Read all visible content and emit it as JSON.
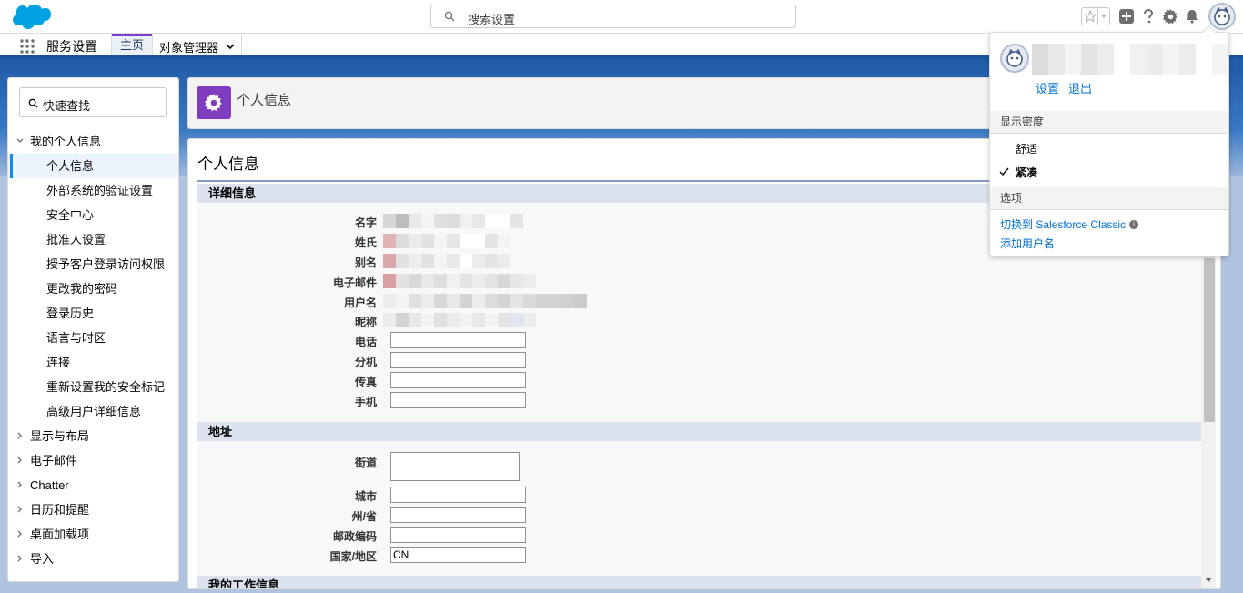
{
  "global_header": {
    "search_placeholder": "搜索设置"
  },
  "nav": {
    "app_name": "服务设置",
    "tabs": [
      {
        "label": "主页"
      },
      {
        "label": "对象管理器"
      }
    ]
  },
  "sidebar": {
    "quickfind_placeholder": "快速查找",
    "items": [
      {
        "label": "我的个人信息"
      },
      {
        "label": "个人信息"
      },
      {
        "label": "外部系统的验证设置"
      },
      {
        "label": "安全中心"
      },
      {
        "label": "批准人设置"
      },
      {
        "label": "授予客户登录访问权限"
      },
      {
        "label": "更改我的密码"
      },
      {
        "label": "登录历史"
      },
      {
        "label": "语言与时区"
      },
      {
        "label": "连接"
      },
      {
        "label": "重新设置我的安全标记"
      },
      {
        "label": "高级用户详细信息"
      },
      {
        "label": "显示与布局"
      },
      {
        "label": "电子邮件"
      },
      {
        "label": "Chatter"
      },
      {
        "label": "日历和提醒"
      },
      {
        "label": "桌面加载项"
      },
      {
        "label": "导入"
      }
    ]
  },
  "page_header": {
    "title": "个人信息"
  },
  "content": {
    "title": "个人信息",
    "sections": [
      {
        "title": "详细信息",
        "fields": [
          {
            "label": "名字"
          },
          {
            "label": "姓氏"
          },
          {
            "label": "别名"
          },
          {
            "label": "电子邮件"
          },
          {
            "label": "用户名"
          },
          {
            "label": "昵称"
          },
          {
            "label": "电话",
            "value": ""
          },
          {
            "label": "分机",
            "value": ""
          },
          {
            "label": "传真",
            "value": ""
          },
          {
            "label": "手机",
            "value": ""
          }
        ]
      },
      {
        "title": "地址",
        "fields": [
          {
            "label": "街道",
            "value": ""
          },
          {
            "label": "城市",
            "value": ""
          },
          {
            "label": "州/省",
            "value": ""
          },
          {
            "label": "邮政编码",
            "value": ""
          },
          {
            "label": "国家/地区",
            "value": "CN"
          }
        ]
      },
      {
        "title": "我的工作信息"
      }
    ]
  },
  "user_panel": {
    "links": [
      {
        "label": "设置"
      },
      {
        "label": "退出"
      }
    ],
    "density_title": "显示密度",
    "density_options": [
      {
        "label": "舒适",
        "checked": false
      },
      {
        "label": "紧凑",
        "checked": true
      }
    ],
    "options_title": "选项",
    "option_links": [
      {
        "label": "切换到 Salesforce Classic"
      },
      {
        "label": "添加用户名"
      }
    ]
  },
  "colors": {
    "brand_blue": "#1b5297",
    "link": "#0070d2",
    "gear_tile": "#7f3cbd",
    "home_tab_accent": "#7a3fcf"
  }
}
